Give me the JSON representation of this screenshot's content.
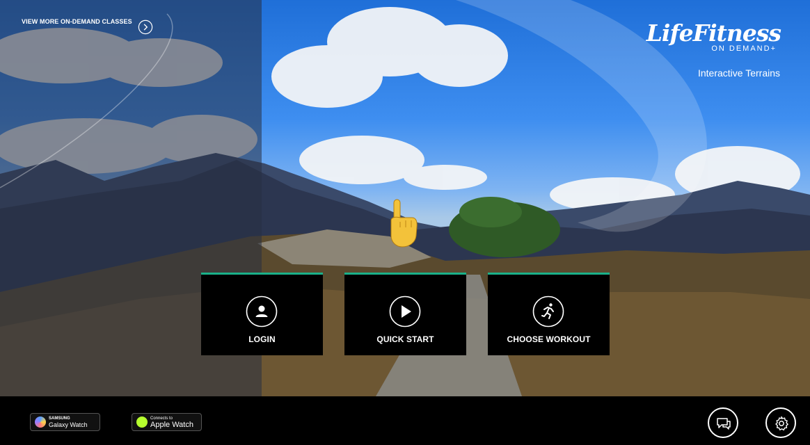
{
  "header": {
    "view_more_label": "VIEW MORE ON-DEMAND CLASSES",
    "brand_logo_text": "LifeFitness",
    "brand_sub_text": "ON DEMAND+",
    "tagline": "Interactive Terrains"
  },
  "tiles": [
    {
      "label": "LOGIN",
      "icon": "user-icon"
    },
    {
      "label": "QUICK START",
      "icon": "play-icon"
    },
    {
      "label": "CHOOSE WORKOUT",
      "icon": "runner-icon"
    }
  ],
  "bottom_bar": {
    "samsung": {
      "small": "SAMSUNG",
      "big": "Galaxy Watch"
    },
    "apple": {
      "small": "Connects to",
      "big": "Apple Watch"
    },
    "buttons": [
      "chat-icon",
      "gear-icon"
    ]
  },
  "colors": {
    "accent": "#1ab089",
    "tile_bg": "#000000",
    "bar_bg": "#000000"
  }
}
